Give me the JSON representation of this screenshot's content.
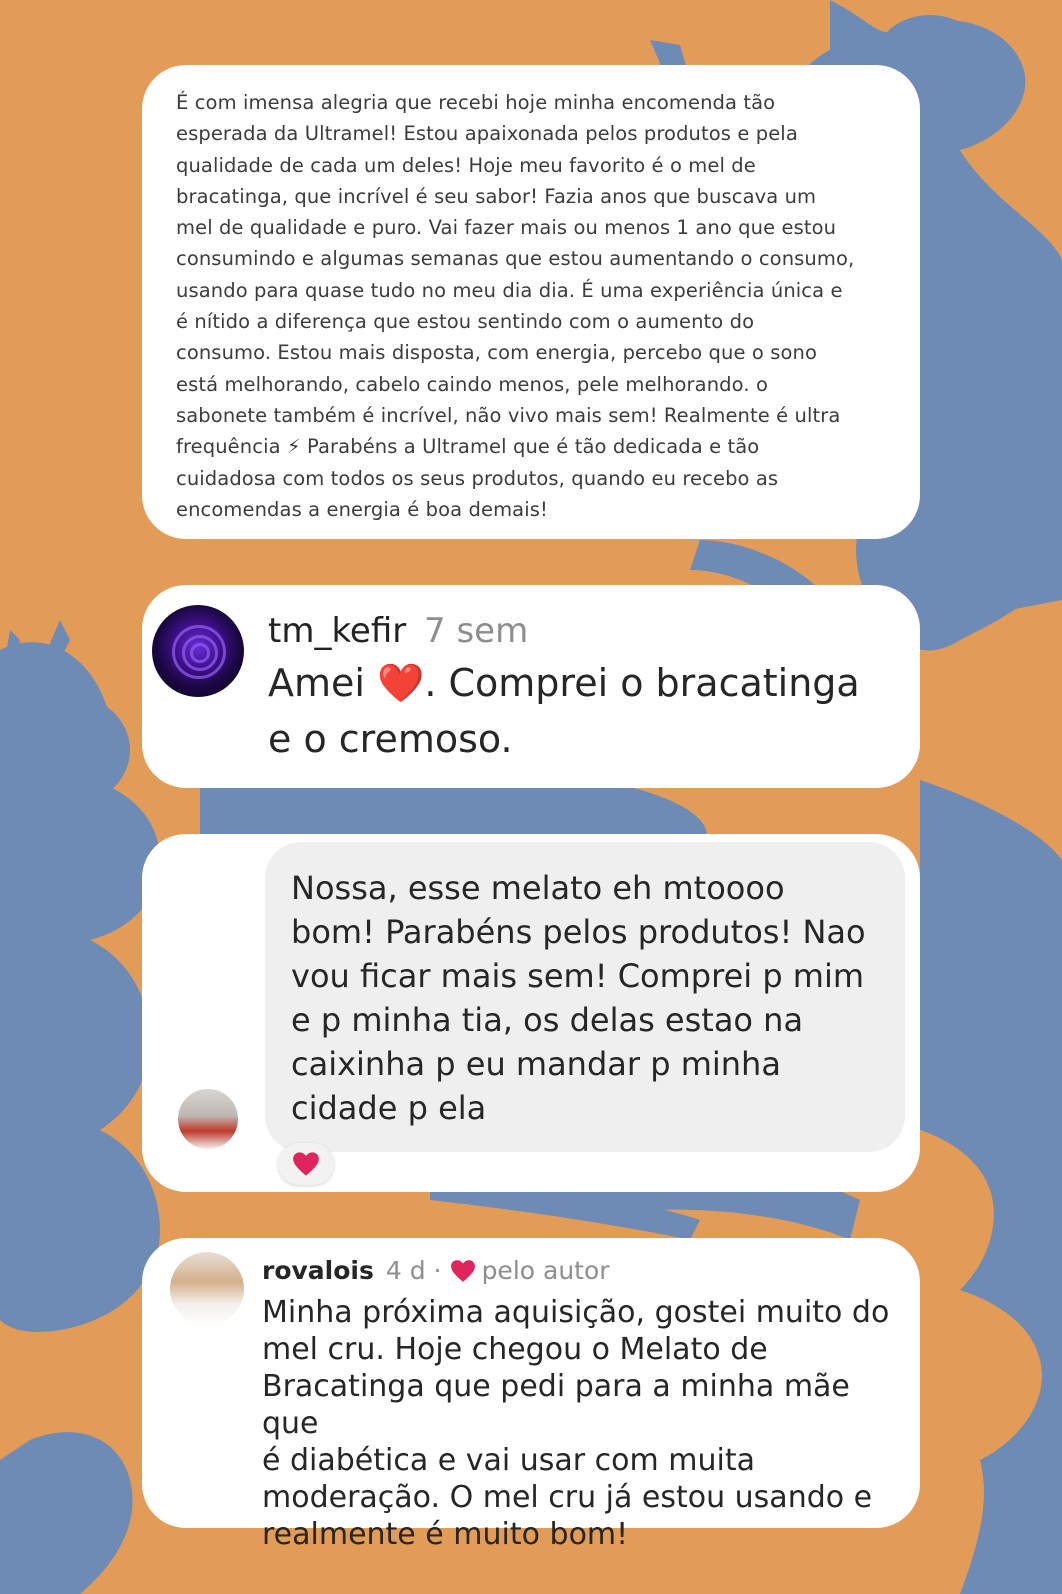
{
  "colors": {
    "background": "#E39C57",
    "bee_silhouette": "#6E8BB5",
    "card": "#FFFFFF",
    "heart": "#E0245E"
  },
  "review_card": {
    "text": "É com imensa alegria que recebi hoje minha encomenda tão\nesperada da Ultramel! Estou apaixonada pelos produtos e pela\nqualidade de cada um deles! Hoje meu favorito é o mel de\nbracatinga, que incrível é seu sabor! Fazia anos que buscava um\nmel de qualidade e puro. Vai fazer mais ou menos 1 ano que estou\nconsumindo e algumas semanas que estou aumentando o consumo,\nusando para quase tudo no meu dia dia. É uma experiência única e\né nítido a diferença que estou sentindo com o aumento do\nconsumo. Estou mais disposta, com energia, percebo que o sono\nestá melhorando, cabelo caindo menos, pele melhorando. o\nsabonete também é incrível, não vivo mais sem! Realmente é ultra\nfrequência ⚡ Parabéns a Ultramel que é tão dedicada e tão\ncuidadosa com todos os seus produtos, quando eu recebo as\nencomendas a energia é boa demais!"
  },
  "comment_kefir": {
    "username": "tm_kefir",
    "time": "7 sem",
    "text": "Amei ❤️. Comprei o bracatinga\ne o cremoso.",
    "avatar_icon": "purple-rose-avatar"
  },
  "message_melato": {
    "text": "Nossa, esse melato eh mtoooo\nbom! Parabéns pelos produtos! Nao\nvou ficar mais sem! Comprei p mim\ne p minha tia, os delas estao na\ncaixinha p eu mandar p minha\ncidade p ela",
    "reaction": "❤️",
    "avatar_icon": "user-photo-avatar"
  },
  "comment_rovalois": {
    "username": "rovalois",
    "time": "4 d",
    "separator": "·",
    "liked_by_author": "pelo autor",
    "text": "Minha próxima aquisição, gostei muito do\nmel cru. Hoje chegou o Melato de\nBracatinga que pedi para a minha mãe que\né diabética e vai usar com muita\nmoderação. O mel cru já estou usando e\nrealmente é muito bom!",
    "avatar_icon": "user-photo-avatar"
  }
}
